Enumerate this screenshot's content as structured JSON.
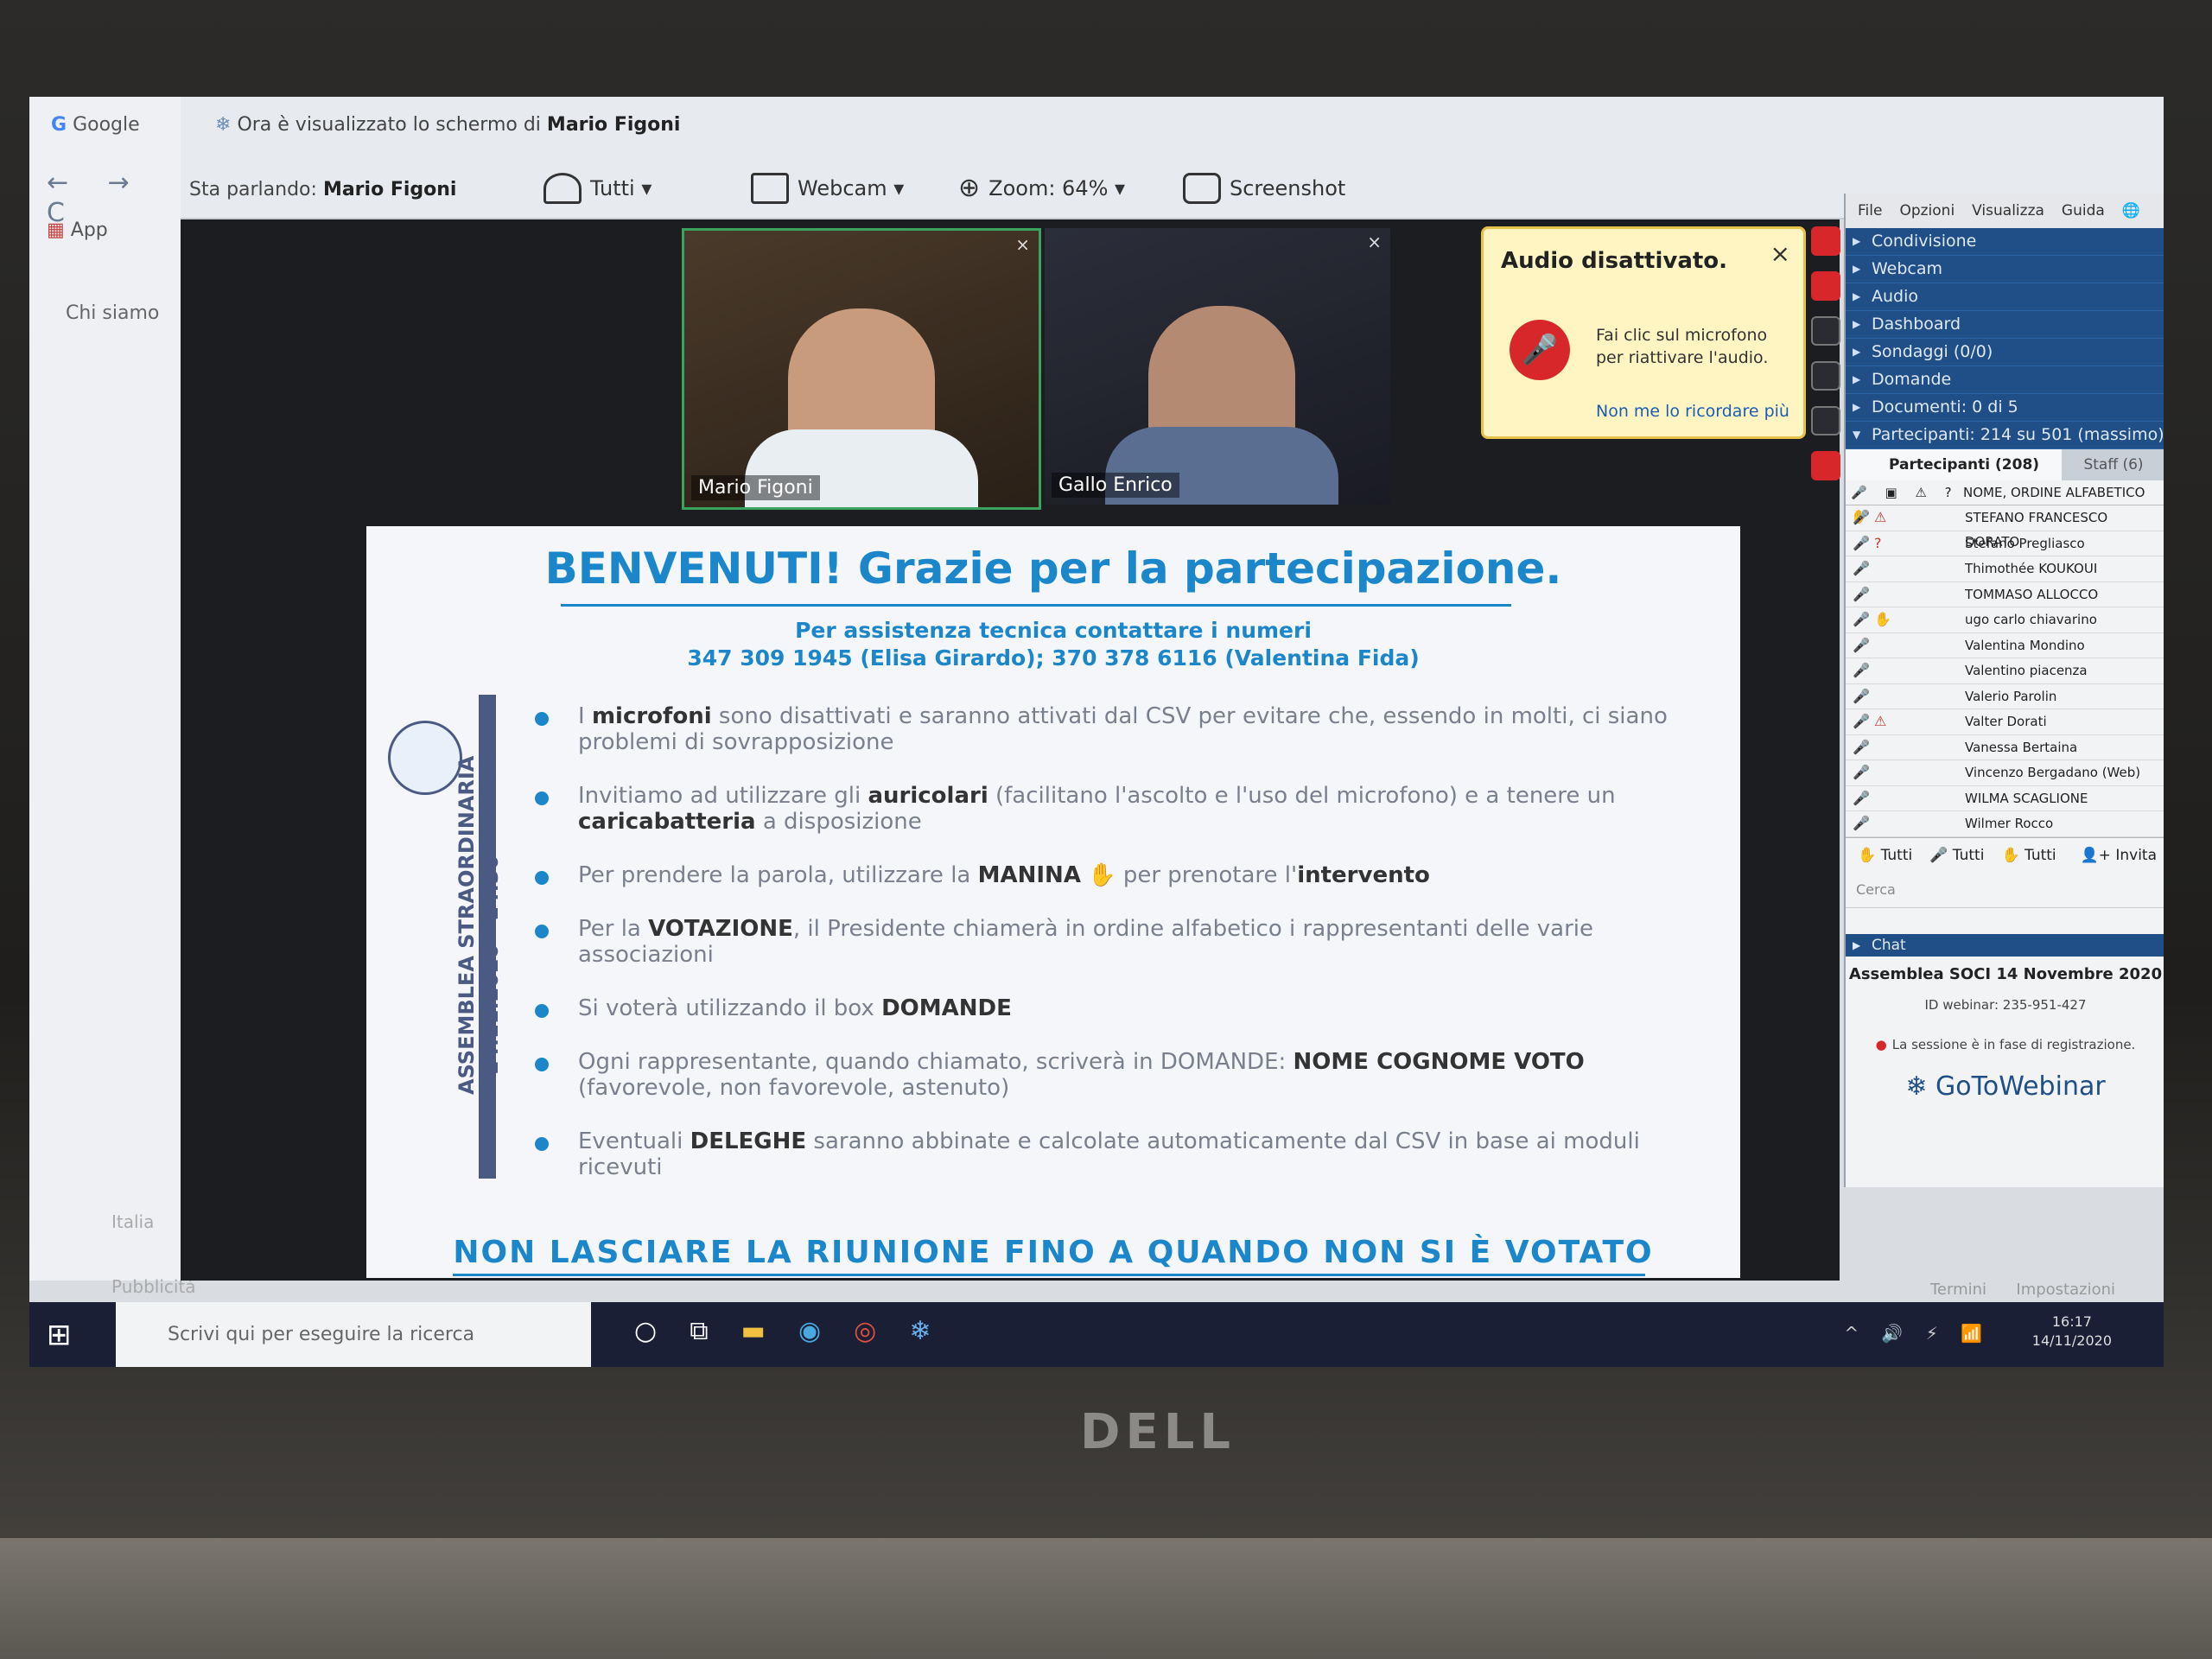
{
  "browser": {
    "tab_label": "Google",
    "nav_icons": "← → C",
    "apps_label": "App",
    "link_chi_siamo": "Chi siamo",
    "footer_country": "Italia",
    "footer_pubblicita": "Pubblicità"
  },
  "viewer": {
    "watching_prefix": "Ora è visualizzato lo schermo di",
    "watching_name": "Mario Figoni",
    "speaking_prefix": "Sta parlando:",
    "speaking_name": "Mario Figoni",
    "btn_tutti": "Tutti ▾",
    "btn_webcam": "Webcam ▾",
    "btn_zoom": "Zoom: 64% ▾",
    "btn_screenshot": "Screenshot"
  },
  "videos": {
    "v1_name": "Mario Figoni",
    "v2_name": "Gallo Enrico",
    "close": "×"
  },
  "slide": {
    "title": "BENVENUTI!  Grazie per la partecipazione.",
    "assist_line1": "Per assistenza tecnica contattare i numeri",
    "assist_line2": "347 309 1945 (Elisa  Girardo); 370 378 6116 (Valentina Fida)",
    "vertical_text": "ASSEMBLEA STRAORDINARIA",
    "vertical_date": "14.11.2020  -  14:30",
    "b1_pre": "I ",
    "b1_bold": "microfoni",
    "b1_post": " sono disattivati e  saranno attivati dal CSV  per evitare che, essendo in molti, ci siano problemi di sovrapposizione",
    "b2_pre": "Invitiamo ad utilizzare gli ",
    "b2_bold1": "auricolari",
    "b2_mid": " (facilitano l'ascolto e l'uso del microfono) e a tenere un ",
    "b2_bold2": "caricabatteria",
    "b2_post": " a disposizione",
    "b3_pre": "Per prendere la parola, utilizzare la ",
    "b3_bold1": "MANINA",
    "b3_mid": " ✋  per prenotare l'",
    "b3_bold2": "intervento",
    "b4_pre": "Per la ",
    "b4_bold": "VOTAZIONE",
    "b4_post": ",  il Presidente  chiamerà  in ordine alfabetico i rappresentanti delle varie associazioni",
    "b5_pre": "Si voterà utilizzando il box  ",
    "b5_bold": "DOMANDE",
    "b6_pre": "Ogni rappresentante, quando chiamato, scriverà in DOMANDE:  ",
    "b6_bold": "NOME COGNOME VOTO",
    "b6_post": " (favorevole, non favorevole, astenuto)",
    "b7_pre": "Eventuali ",
    "b7_bold": "DELEGHE",
    "b7_post": " saranno abbinate e calcolate automaticamente dal CSV in base ai moduli ricevuti",
    "footer": "NON LASCIARE LA RIUNIONE FINO A QUANDO NON SI È VOTATO"
  },
  "popup": {
    "title": "Audio disattivato.",
    "close": "×",
    "text": "Fai clic sul microfono per riattivare l'audio.",
    "link": "Non me lo ricordare più"
  },
  "panel": {
    "menu": [
      "File",
      "Opzioni",
      "Visualizza",
      "Guida"
    ],
    "sections": [
      "Condivisione",
      "Webcam",
      "Audio",
      "Dashboard",
      "Sondaggi (0/0)",
      "Domande",
      "Documenti: 0 di 5",
      "Partecipanti: 214 su 501 (massimo)"
    ],
    "tab_participants": "Partecipanti (208)",
    "tab_staff": "Staff (6)",
    "col_icons": "🎤 ▣ ⚠ ? ✋",
    "col_name": "NOME, ORDINE ALFABETICO",
    "participants": [
      {
        "icon": "🎤 ⚠",
        "name": "STEFANO FRANCESCO DORATO"
      },
      {
        "icon": "🎤 ?",
        "name": "Stefano Pregliasco"
      },
      {
        "icon": "🎤",
        "name": "Thimothée KOUKOUI"
      },
      {
        "icon": "🎤",
        "name": "TOMMASO ALLOCCO"
      },
      {
        "icon": "🎤 ✋",
        "name": "ugo carlo chiavarino"
      },
      {
        "icon": "🎤",
        "name": "Valentina Mondino"
      },
      {
        "icon": "🎤",
        "name": "Valentino piacenza"
      },
      {
        "icon": "🎤",
        "name": "Valerio Parolin"
      },
      {
        "icon": "🎤 ⚠",
        "name": "Valter Dorati"
      },
      {
        "icon": "🎤",
        "name": "Vanessa Bertaina"
      },
      {
        "icon": "🎤",
        "name": "Vincenzo Bergadano (Web)"
      },
      {
        "icon": "🎤",
        "name": "WILMA SCAGLIONE"
      },
      {
        "icon": "🎤",
        "name": "Wilmer Rocco"
      }
    ],
    "filter1": "Tutti",
    "filter2": "Tutti",
    "filter3": "Tutti",
    "invite": "Invita",
    "search_placeholder": "Cerca",
    "chat": "Chat",
    "chat_title": "Assemblea SOCI 14 Novembre 2020",
    "webinar_id": "ID webinar: 235-951-427",
    "recording": "La sessione è in fase di registrazione.",
    "brand": "GoToWebinar",
    "termini": "Termini",
    "impostazioni": "Impostazioni"
  },
  "taskbar": {
    "search_placeholder": "Scrivi qui per eseguire la ricerca",
    "time": "16:17",
    "date": "14/11/2020"
  },
  "hardware": {
    "brand": "DELL"
  }
}
